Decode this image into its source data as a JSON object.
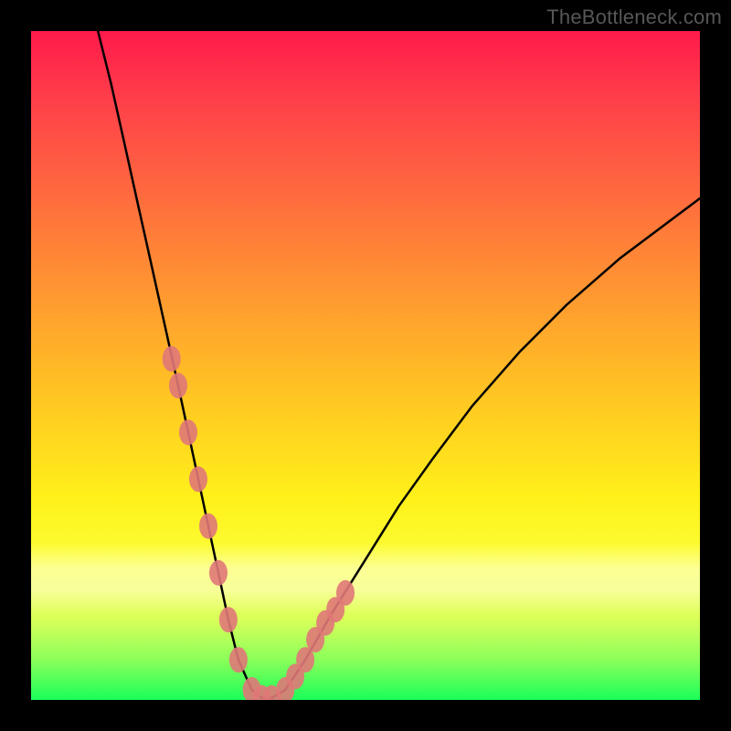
{
  "watermark": "TheBottleneck.com",
  "chart_data": {
    "type": "line",
    "title": "",
    "xlabel": "",
    "ylabel": "",
    "xlim": [
      0,
      100
    ],
    "ylim": [
      0,
      100
    ],
    "grid": false,
    "legend": false,
    "series": [
      {
        "name": "bottleneck-curve",
        "color": "#000000",
        "x": [
          10,
          12,
          14,
          16,
          18,
          20,
          22,
          23.5,
          25,
          26.5,
          28,
          29.5,
          31,
          33,
          34.5,
          36,
          38,
          41,
          45,
          50,
          55,
          60,
          66,
          73,
          80,
          88,
          96,
          100
        ],
        "values": [
          100,
          92,
          83,
          74,
          65,
          56,
          47,
          40,
          33,
          26,
          19,
          12,
          6,
          1.5,
          0.3,
          0.3,
          1.5,
          6,
          13,
          21,
          29,
          36,
          44,
          52,
          59,
          66,
          72,
          75
        ]
      },
      {
        "name": "highlight-dots",
        "color": "#e07878",
        "type": "scatter",
        "x": [
          21,
          22,
          23.5,
          25,
          26.5,
          28,
          29.5,
          31,
          33,
          34.5,
          36,
          38,
          39.5,
          41,
          42.5,
          44,
          45.5,
          47
        ],
        "values": [
          51,
          47,
          40,
          33,
          26,
          19,
          12,
          6,
          1.5,
          0.3,
          0.3,
          1.5,
          3.5,
          6,
          9,
          11.5,
          13.5,
          16
        ]
      }
    ],
    "band": {
      "y0": 13,
      "y1": 24,
      "color": "#ffffdc"
    }
  }
}
